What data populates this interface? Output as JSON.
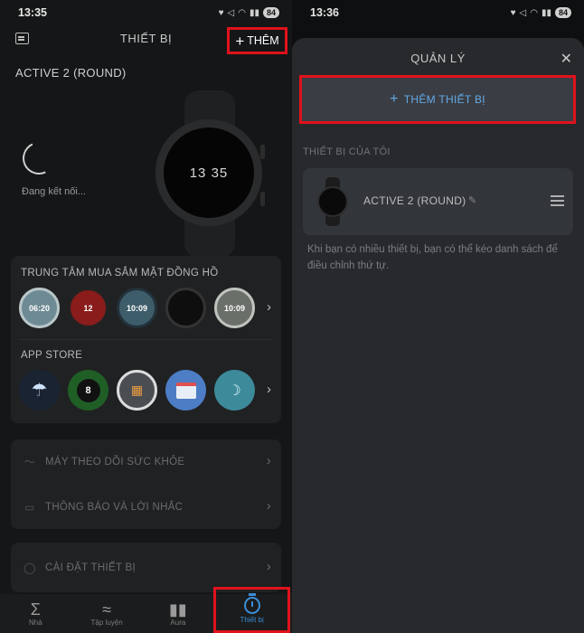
{
  "left": {
    "status": {
      "time": "13:35",
      "battery": "84"
    },
    "header": {
      "title": "THIẾT BỊ",
      "add_label": "THÊM"
    },
    "device_name": "ACTIVE 2 (ROUND)",
    "connection_status": "Đang kết nối...",
    "watch_time": "13 35",
    "watchface_store": {
      "title": "TRUNG TÂM MUA SẮM MẶT ĐỒNG HỒ",
      "items": [
        {
          "label": "06:20",
          "color": "#6e8a94"
        },
        {
          "label": "12",
          "color": "#8a1c1c"
        },
        {
          "label": "10:09",
          "color": "#3e5d6b"
        },
        {
          "label": "",
          "color": "#0e0e0e"
        },
        {
          "label": "10:09",
          "color": "#6b6f6a"
        }
      ]
    },
    "app_store": {
      "title": "APP STORE",
      "items": [
        {
          "icon": "umbrella-app-icon",
          "color": "#1a2332"
        },
        {
          "icon": "eight-ball-app-icon",
          "color": "#1f5f26"
        },
        {
          "icon": "calculator-app-icon",
          "color": "#4a4d52"
        },
        {
          "icon": "calendar-app-icon",
          "color": "#4d7dc4"
        },
        {
          "icon": "tarot-app-icon",
          "color": "#3d8a9a"
        }
      ]
    },
    "menu": [
      {
        "label": "MÁY THEO DÕI SỨC KHỎE",
        "icon": "pulse-icon"
      },
      {
        "label": "THÔNG BÁO VÀ LỜI NHẮC",
        "icon": "chat-bubble-icon"
      }
    ],
    "settings_label": "CÀI ĐẶT THIẾT BỊ",
    "nav": [
      {
        "label": "Nhà",
        "icon": "sigma-icon"
      },
      {
        "label": "Tập luyện",
        "icon": "run-icon"
      },
      {
        "label": "Aura",
        "icon": "sound-wave-icon"
      },
      {
        "label": "Thiết bị",
        "icon": "stopwatch-icon"
      }
    ]
  },
  "right": {
    "status": {
      "time": "13:36",
      "battery": "84"
    },
    "sheet_title": "QUẢN LÝ",
    "add_device_label": "THÊM THIẾT BỊ",
    "my_devices_title": "THIẾT BỊ CỦA TÔI",
    "device": {
      "name": "ACTIVE 2 (ROUND)"
    },
    "hint": "Khi bạn có nhiều thiết bị, bạn có thể kéo danh sách để điều chỉnh thứ tự."
  },
  "colors": {
    "highlight": "#e0121c",
    "accent": "#3a8ed8",
    "add_device_text": "#64a8e6"
  }
}
